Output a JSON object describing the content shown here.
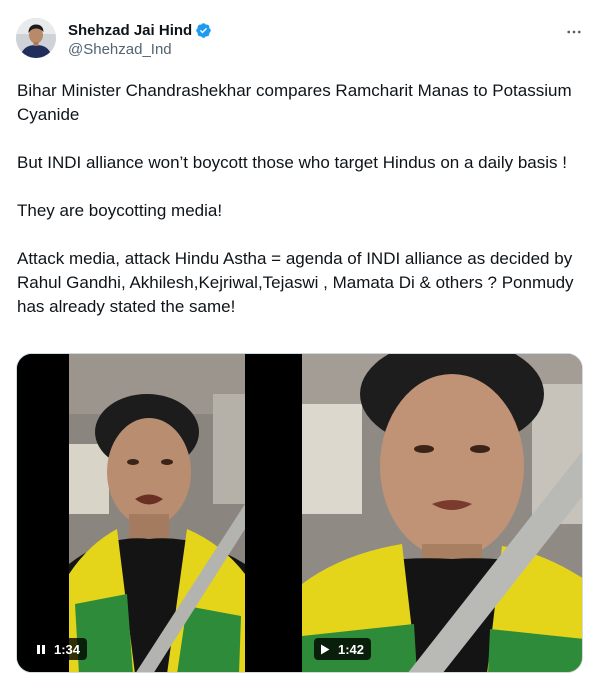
{
  "author": {
    "display_name": "Shehzad Jai Hind",
    "handle": "@Shehzad_Ind",
    "verified": true,
    "verified_color": "#1d9bf0",
    "avatar_icon": "profile-photo"
  },
  "more_icon": "ellipsis-icon",
  "tweet": {
    "paragraphs": [
      "Bihar Minister Chandrashekhar compares Ramcharit Manas to Potassium Cyanide",
      "But INDI alliance won’t boycott those who target Hindus on a daily basis !",
      "They are boycotting media!",
      "Attack media, attack Hindu Astha = agenda of INDI alliance as decided by Rahul Gandhi, Akhilesh,Kejriwal,Tejaswi , Mamata Di & others ? Ponmudy has already stated the same!"
    ]
  },
  "media": {
    "videos": [
      {
        "state_icon": "pause-icon",
        "duration": "1:34"
      },
      {
        "state_icon": "play-icon",
        "duration": "1:42"
      }
    ]
  },
  "colors": {
    "text_primary": "#0f1419",
    "text_secondary": "#536471",
    "border": "#cfd9de",
    "scarf_yellow": "#e5d51a",
    "scarf_green": "#2e8b3a"
  }
}
